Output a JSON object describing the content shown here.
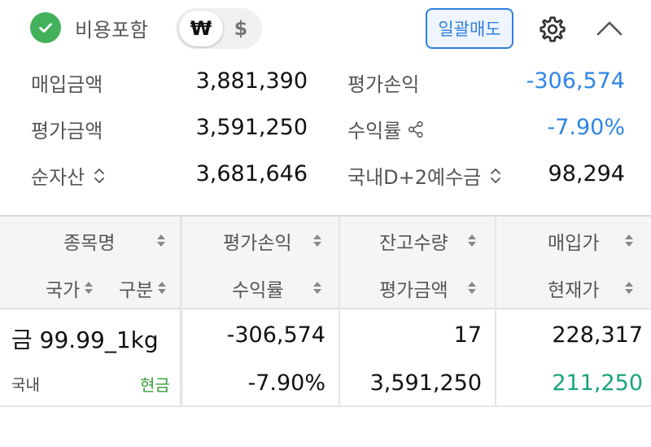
{
  "header": {
    "include_fees_label": "비용포함",
    "currency_options": [
      "₩",
      "$"
    ],
    "selected_currency": "₩",
    "bulk_sell_label": "일괄매도",
    "icons": [
      "check-circle-icon",
      "gear-icon",
      "chevron-up-icon"
    ]
  },
  "summary": {
    "purchase_amount_label": "매입금액",
    "purchase_amount": "3,881,390",
    "eval_pl_label": "평가손익",
    "eval_pl": "-306,574",
    "eval_amount_label": "평가금액",
    "eval_amount": "3,591,250",
    "return_rate_label": "수익률",
    "return_rate": "-7.90%",
    "net_assets_label": "순자산",
    "net_assets": "3,681,646",
    "deposit_label": "국내D+2예수금",
    "deposit": "98,294"
  },
  "table": {
    "headers": {
      "col1_top": "종목명",
      "col1_bottom_a": "국가",
      "col1_bottom_b": "구분",
      "col2_top": "평가손익",
      "col2_bottom": "수익률",
      "col3_top": "잔고수량",
      "col3_bottom": "평가금액",
      "col4_top": "매입가",
      "col4_bottom": "현재가"
    },
    "rows": [
      {
        "name": "금 99.99_1kg",
        "country": "국내",
        "type": "현금",
        "eval_pl": "-306,574",
        "return_rate": "-7.90%",
        "quantity": "17",
        "eval_amount": "3,591,250",
        "purchase_price": "228,317",
        "current_price": "211,250"
      }
    ]
  },
  "colors": {
    "negative": "#2f86e6",
    "current_price": "#1aa37a",
    "accent": "#2f7fe0",
    "check": "#43b05c"
  }
}
